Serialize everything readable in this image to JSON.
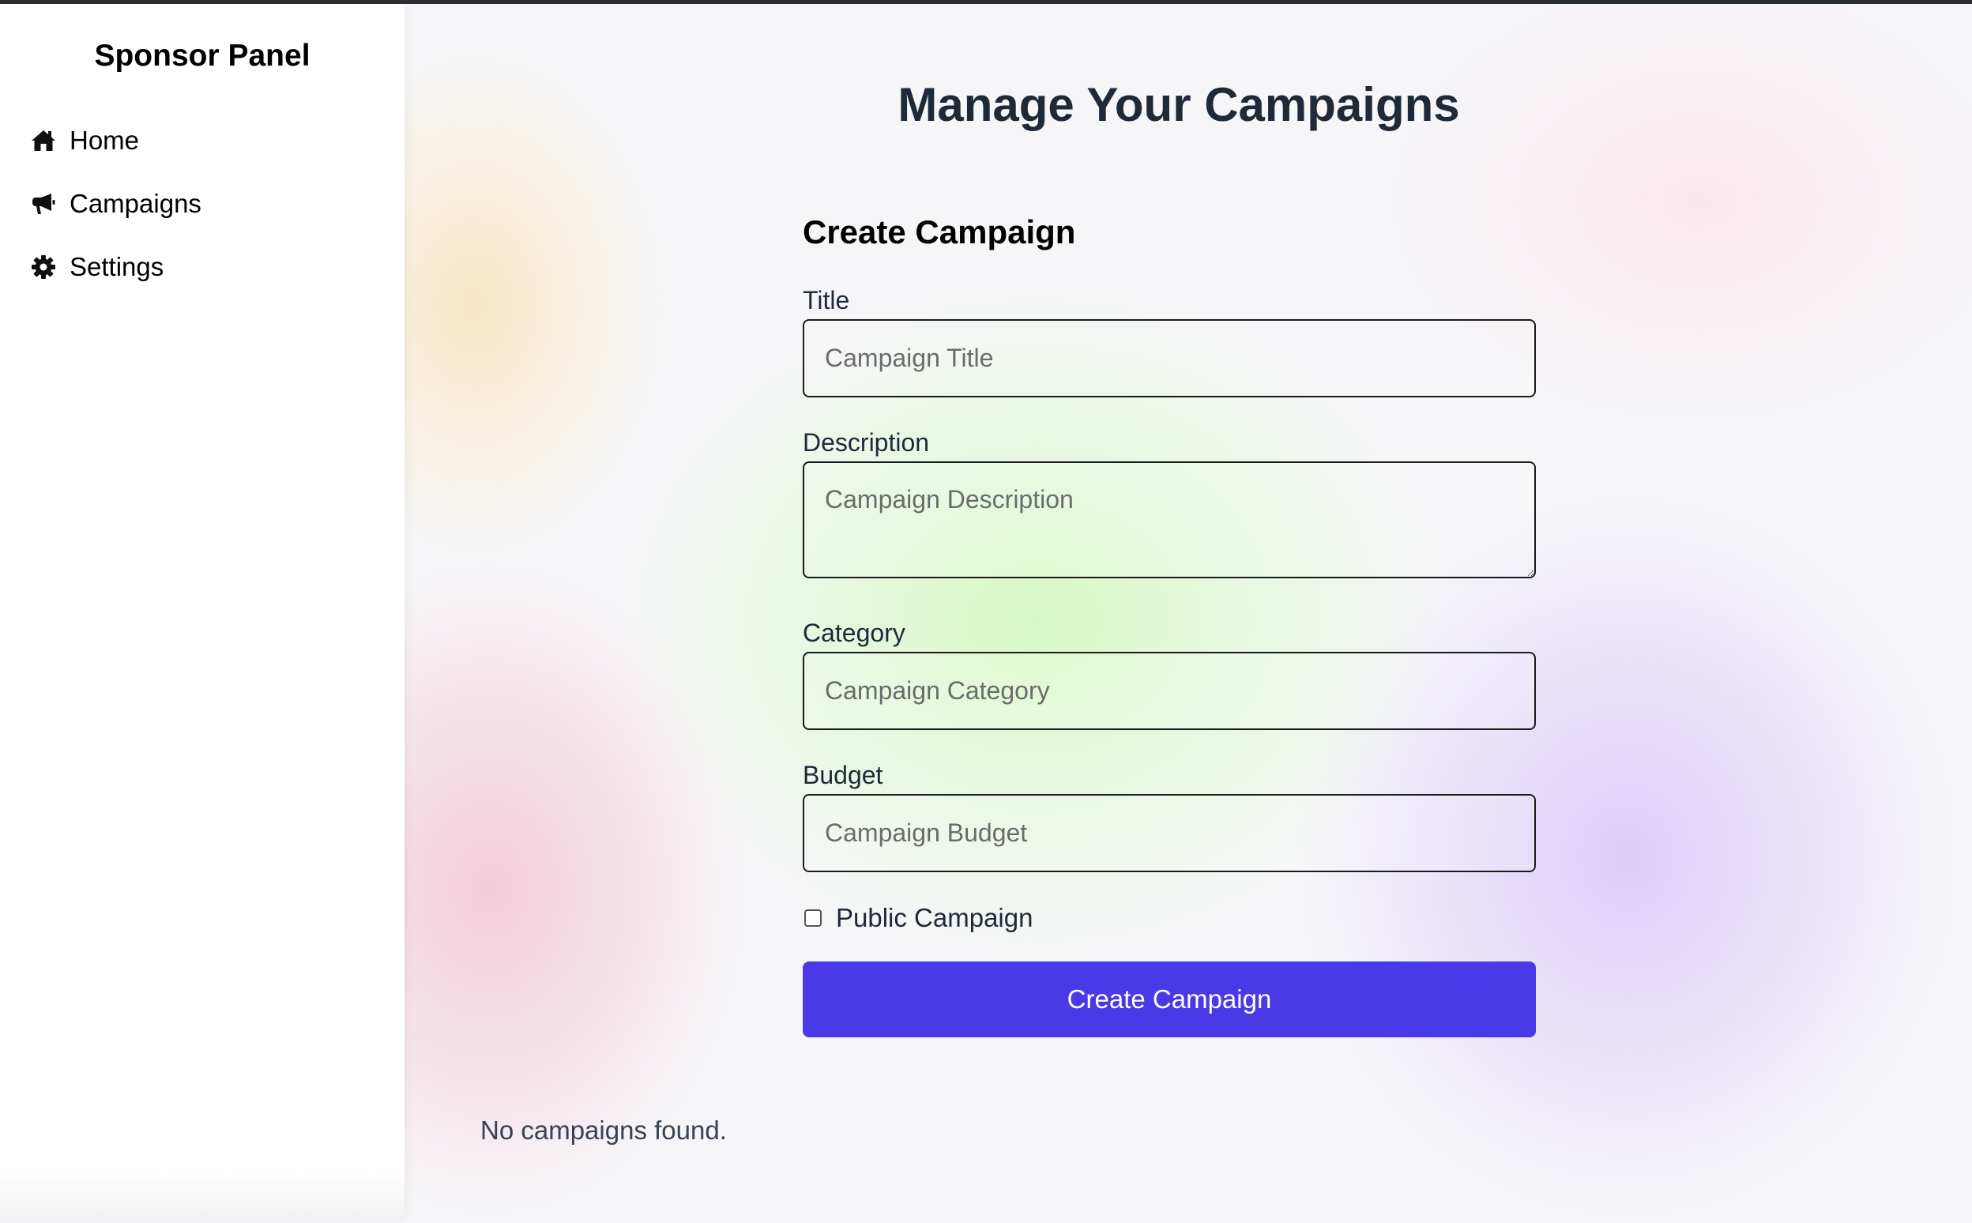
{
  "sidebar": {
    "title": "Sponsor Panel",
    "items": [
      {
        "label": "Home",
        "icon": "home-icon"
      },
      {
        "label": "Campaigns",
        "icon": "megaphone-icon"
      },
      {
        "label": "Settings",
        "icon": "gear-icon"
      }
    ]
  },
  "main": {
    "title": "Manage Your Campaigns",
    "form": {
      "heading": "Create Campaign",
      "fields": {
        "title": {
          "label": "Title",
          "placeholder": "Campaign Title",
          "value": ""
        },
        "description": {
          "label": "Description",
          "placeholder": "Campaign Description",
          "value": ""
        },
        "category": {
          "label": "Category",
          "placeholder": "Campaign Category",
          "value": ""
        },
        "budget": {
          "label": "Budget",
          "placeholder": "Campaign Budget",
          "value": ""
        }
      },
      "public_checkbox": {
        "label": "Public Campaign",
        "checked": false
      },
      "submit_label": "Create Campaign"
    },
    "empty_message": "No campaigns found."
  },
  "colors": {
    "accent": "#4a39e6",
    "heading": "#1f2937",
    "sidebar_bg": "#ffffff"
  }
}
